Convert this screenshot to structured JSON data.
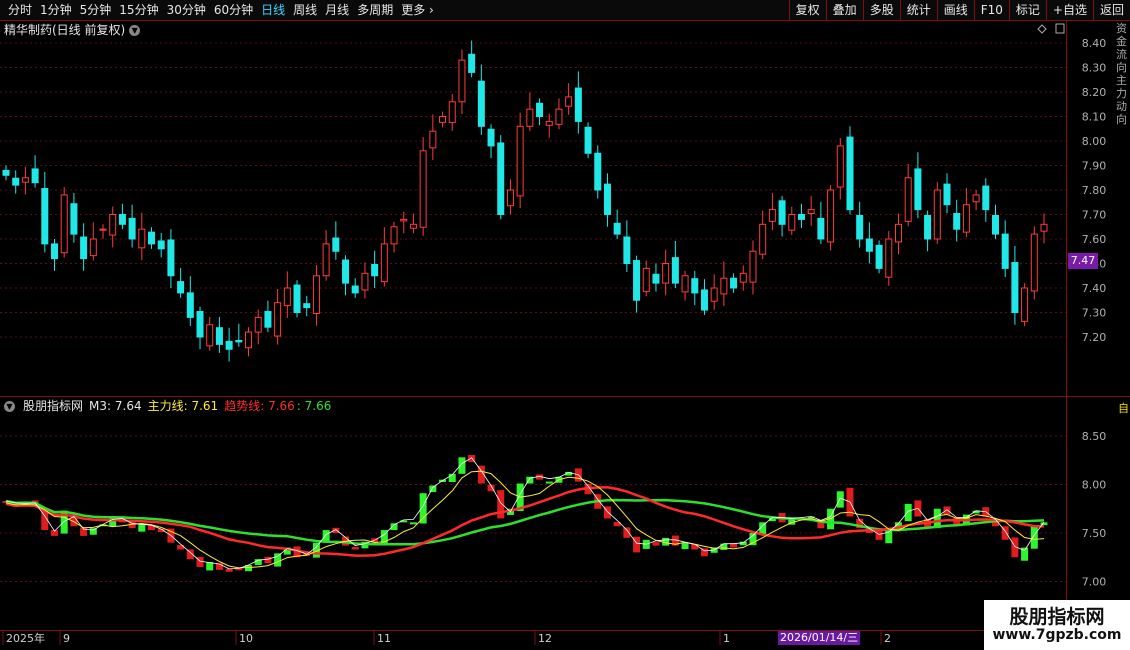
{
  "toolbar": {
    "tabs": [
      "分时",
      "1分钟",
      "5分钟",
      "15分钟",
      "30分钟",
      "60分钟",
      "日线",
      "周线",
      "月线",
      "多周期",
      "更多"
    ],
    "active_tab": "日线",
    "more_arrow": "›",
    "tools": [
      "复权",
      "叠加",
      "多股",
      "统计",
      "画线",
      "F10",
      "标记",
      "+自选",
      "返回"
    ]
  },
  "stock": {
    "title": "精华制药(日线 前复权)"
  },
  "price_axis": {
    "labels": [
      "8.40",
      "8.30",
      "8.20",
      "8.10",
      "8.00",
      "7.90",
      "7.80",
      "7.70",
      "7.60",
      "7.50",
      "7.40",
      "7.30",
      "7.20"
    ]
  },
  "current_price": "7.47",
  "indicator": {
    "name": "股朋指标网",
    "m3_label": "M3:",
    "m3_value": "7.64",
    "zl_label": "主力线:",
    "zl_value": "7.61",
    "qs_label": "趋势线:",
    "qs_value": "7.66",
    "extra": ": 7.66",
    "axis_labels": [
      "8.50",
      "8.00",
      "7.50",
      "7.00"
    ]
  },
  "time_axis": {
    "labels": [
      "2025年",
      "9",
      "10",
      "11",
      "12",
      "1",
      "2"
    ]
  },
  "date_box": "2026/01/14/三",
  "watermark": {
    "line1": "股朋指标网",
    "line2": "www.7gpzb.com"
  },
  "side_panel_text": "资金流向主力动向",
  "side_yellow": "自",
  "colors": {
    "up": "#ff3b3b",
    "down": "#20e8e8",
    "ind_up": "#2cf52c",
    "ind_red": "#e01c1c",
    "trend": "#ff2a2a",
    "main": "#ffea3a",
    "long": "#2ee02e"
  }
}
